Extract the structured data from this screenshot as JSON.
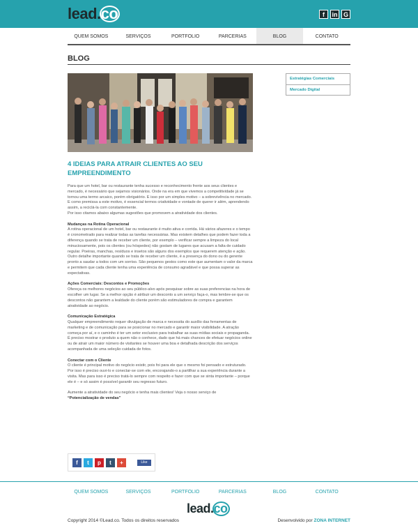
{
  "brand": {
    "logo_main": "lead",
    "logo_dot": ".",
    "logo_co": "co"
  },
  "social": [
    {
      "icon": "facebook-icon",
      "glyph": "f"
    },
    {
      "icon": "linkedin-icon",
      "glyph": "in"
    },
    {
      "icon": "google-icon",
      "glyph": "G"
    }
  ],
  "nav": {
    "items": [
      "QUEM SOMOS",
      "SERVIÇOS",
      "PORTFOLIO",
      "PARCERIAS",
      "BLOG",
      "CONTATO"
    ],
    "active": "BLOG"
  },
  "page": {
    "title": "BLOG"
  },
  "post": {
    "title": "4 IDEIAS PARA ATRAIR CLIENTES AO SEU EMPREENDIMENTO",
    "intro_1": "Para que um hotel, bar ou restaurante tenha sucesso e reconhecimento frente aos seus clientes e mercado, é necessário que sejamos visionários. Onde na era em que vivemos a competitividade já se tornou uma termo arcaico, porém obrigatório. E isso por um simples motivo – a sobrevivência no mercado. E como premissa a este motivo, é essencial termos criatividade e vontade de querer ir além, aprendendo assim, a reciclá-la com constantemente.",
    "intro_2": "Por isso citamos abaixo algumas sugestões que promovem a atratividade dos clientes.",
    "s1_title": "Mudanças na Rotina Operacional",
    "s1_p1": "A rotina operacional de um hotel, bar ou restaurante é muito ativa e corrida. Há vários afazeres e o tempo é cronometrado para realizar todas as tarefas necessárias. Mas existem detalhes que podem fazer toda a diferença quando se trata de receber um cliente, por exemplo – verificar sempre a limpeza do local minuciosamente, pois os clientes (ou hóspedes) não gostam de lugares que acusam a falta de cuidado regular. Poeiras, manchas, resíduos e insetos são alguns dos exemplos que requerem atenção e ação.",
    "s1_p2": "Outro detalhe importante quando se trata de receber um cliente, é a presença do dono ou do gerente pronto a saudar a todos com um sorriso. São pequenos gestos como este que aumentam o valor da marca e permitem que cada cliente tenha uma experiência de consumo agradável e que possa superar as expectativas.",
    "s2_title": "Ações Comerciais: Descontos e Promoções",
    "s2_p1": "Ofereça os melhores negócios ao seu público-alvo após pesquisar sobre as suas preferencias na hora de escolher um lugar. Se a melhor opção é atribuir um desconto a um serviço faça-o, mas lembre-se que os descontos não garantem a lealdade do cliente porém são estimuladores de compra e garantem atratividade ao negócio.",
    "s3_title": "Comunicação Estratégica",
    "s3_p1": "Qualquer empreendimento requer divulgação de marca e necessita do auxílio das ferramentas de marketing e de comunicação para se posicionar no mercado e garantir maior visibilidade. A atração começa por aí, e o caminho é ter um setor exclusivo para trabalhar as suas mídias sociais e propaganda.",
    "s3_p2": "É preciso mostrar o produto a quem não o conhece, dado que há mais chances de efetuar negócios online ou de atrair um maior número de visitantes se houver uma boa e detalhada descrição dos serviços acompanhada de uma seleção cuidada de fotos.",
    "s4_title": "Conectar com o Cliente",
    "s4_p1": "O cliente é principal motivo do negócio existir, pois foi para ele que o mesmo foi pensado e estruturado. Por isso é preciso ouvi-lo e conectar-se com ele, encorajando-o a partilhar a sua experiência durante a visita. Mas para isso é preciso tratá-lo sempre com respeito e fazer com que se sinta importante – porque ele é – e só assim é possível garantir seu regresso futuro.",
    "cta": "Aumente a atratividade do seu negócio e tenha mais clientes! Veja o nosso serviço de",
    "cta_link": "“Potencialização de vendas”"
  },
  "share": {
    "icons": [
      {
        "icon": "facebook-share-icon",
        "glyph": "f",
        "color": "#3b5998"
      },
      {
        "icon": "twitter-share-icon",
        "glyph": "t",
        "color": "#2aa9e0"
      },
      {
        "icon": "pinterest-share-icon",
        "glyph": "p",
        "color": "#cb2027"
      },
      {
        "icon": "tumblr-share-icon",
        "glyph": "t",
        "color": "#34526f"
      },
      {
        "icon": "google-plus-share-icon",
        "glyph": "+",
        "color": "#dd4b39"
      }
    ],
    "like_label": "Like"
  },
  "sidebar": {
    "items": [
      "Estratégias Comerciais",
      "Mercado Digital"
    ]
  },
  "footer": {
    "nav": [
      "QUEM SOMOS",
      "SERVIÇOS",
      "PORTFOLIO",
      "PARCERIAS",
      "BLOG",
      "CONTATO"
    ],
    "copyright": "Copyright 2014 ©Lead.co. Todos os direitos reservados",
    "dev_prefix": "Desenvolvido por",
    "dev_name": "ZONA INTERNET"
  },
  "colors": {
    "accent": "#26a2ad",
    "dark": "#1d2b2d"
  }
}
